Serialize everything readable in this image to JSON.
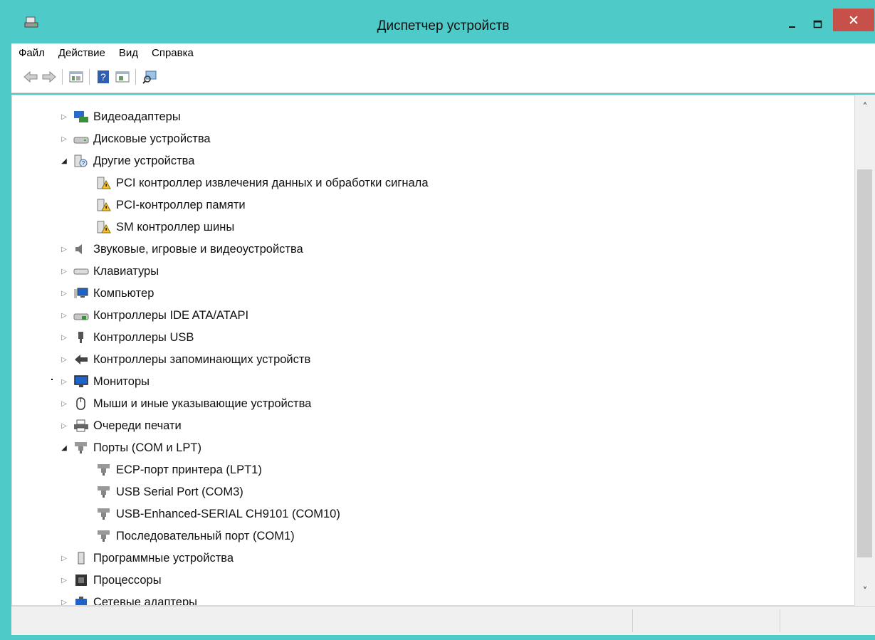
{
  "window": {
    "title": "Диспетчер устройств",
    "accent": "#4ecbc9",
    "close_color": "#c7504a"
  },
  "menu": [
    "Файл",
    "Действие",
    "Вид",
    "Справка"
  ],
  "toolbar_icons": [
    "back-arrow-icon",
    "forward-arrow-icon",
    "properties-icon",
    "help-icon",
    "update-driver-icon",
    "scan-hardware-icon"
  ],
  "tree": [
    {
      "label": "Видеоадаптеры",
      "expanded": false,
      "icon": "display-adapter-icon"
    },
    {
      "label": "Дисковые устройства",
      "expanded": false,
      "icon": "disk-drive-icon"
    },
    {
      "label": "Другие устройства",
      "expanded": true,
      "icon": "unknown-device-icon",
      "children": [
        {
          "label": "PCI контроллер извлечения данных и обработки сигнала",
          "icon": "warning-device-icon"
        },
        {
          "label": "PCI-контроллер памяти",
          "icon": "warning-device-icon"
        },
        {
          "label": "SM контроллер шины",
          "icon": "warning-device-icon"
        }
      ]
    },
    {
      "label": "Звуковые, игровые и видеоустройства",
      "expanded": false,
      "icon": "speaker-icon"
    },
    {
      "label": "Клавиатуры",
      "expanded": false,
      "icon": "keyboard-icon"
    },
    {
      "label": "Компьютер",
      "expanded": false,
      "icon": "computer-icon"
    },
    {
      "label": "Контроллеры IDE ATA/ATAPI",
      "expanded": false,
      "icon": "ide-controller-icon"
    },
    {
      "label": "Контроллеры USB",
      "expanded": false,
      "icon": "usb-icon"
    },
    {
      "label": "Контроллеры запоминающих устройств",
      "expanded": false,
      "icon": "storage-controller-icon"
    },
    {
      "label": "Мониторы",
      "expanded": false,
      "icon": "monitor-icon"
    },
    {
      "label": "Мыши и иные указывающие устройства",
      "expanded": false,
      "icon": "mouse-icon"
    },
    {
      "label": "Очереди печати",
      "expanded": false,
      "icon": "printer-icon"
    },
    {
      "label": "Порты (COM и LPT)",
      "expanded": true,
      "icon": "port-icon",
      "children": [
        {
          "label": "ECP-порт принтера (LPT1)",
          "icon": "port-icon"
        },
        {
          "label": "USB Serial Port (COM3)",
          "icon": "port-icon"
        },
        {
          "label": "USB-Enhanced-SERIAL CH9101 (COM10)",
          "icon": "port-icon"
        },
        {
          "label": "Последовательный порт (COM1)",
          "icon": "port-icon"
        }
      ]
    },
    {
      "label": "Программные устройства",
      "expanded": false,
      "icon": "software-device-icon"
    },
    {
      "label": "Процессоры",
      "expanded": false,
      "icon": "processor-icon"
    },
    {
      "label": "Сетевые адаптеры",
      "expanded": false,
      "icon": "network-adapter-icon"
    }
  ]
}
